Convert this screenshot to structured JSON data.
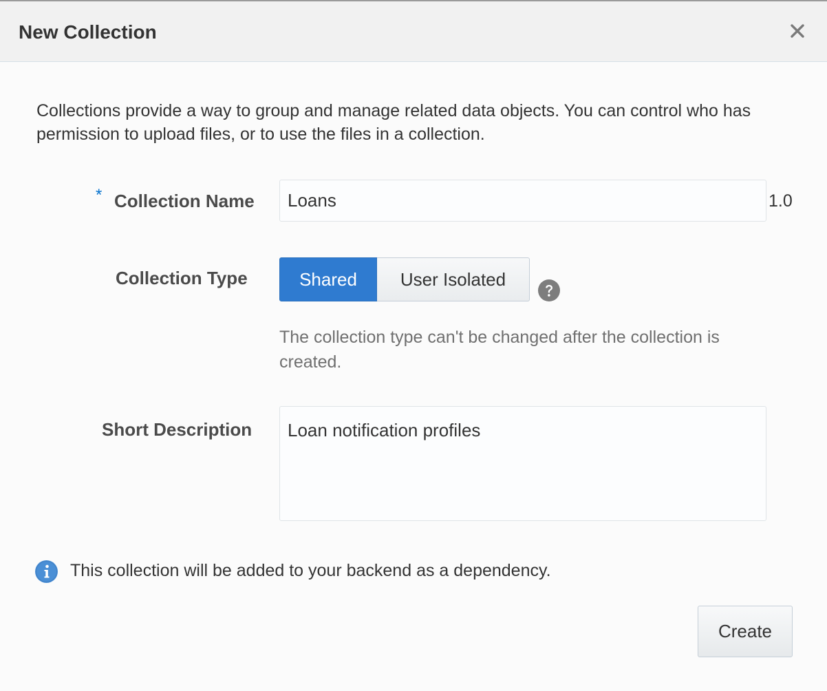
{
  "dialog": {
    "title": "New Collection",
    "close_icon": "close-icon"
  },
  "intro": "Collections provide a way to group and manage related data objects. You can control who has permission to upload files, or to use the files in a collection.",
  "form": {
    "required_marker": "*",
    "name_label": "Collection Name",
    "name_value": "Loans",
    "version": "1.0",
    "type_label": "Collection Type",
    "type_options": [
      "Shared",
      "User Isolated"
    ],
    "type_selected": "Shared",
    "help_icon": "question-circle-icon",
    "type_hint": "The collection type can't be changed after the collection is created.",
    "description_label": "Short Description",
    "description_value": "Loan notification profiles"
  },
  "info": {
    "icon": "info-circle-icon",
    "text": "This collection will be added to your backend as a dependency."
  },
  "footer": {
    "create_label": "Create"
  },
  "colors": {
    "accent": "#2f7bd0",
    "required": "#0572ce",
    "info_icon": "#4a8fd6"
  }
}
